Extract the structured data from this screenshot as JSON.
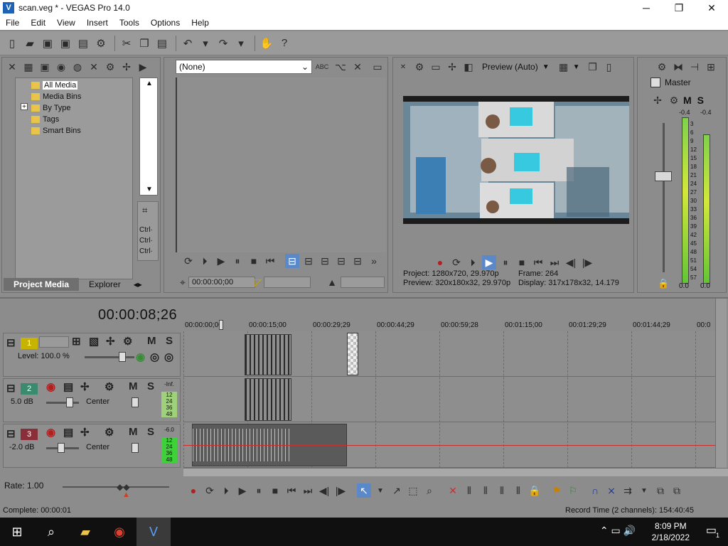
{
  "window": {
    "title": "scan.veg * - VEGAS Pro 14.0",
    "controls": [
      "─",
      "❐",
      "✕"
    ]
  },
  "menu": [
    "File",
    "Edit",
    "View",
    "Insert",
    "Tools",
    "Options",
    "Help"
  ],
  "project_media": {
    "tree": [
      "All Media",
      "Media Bins",
      "By Type",
      "Tags",
      "Smart Bins"
    ],
    "expand_symbol": "+",
    "ctrl_labels": [
      "Ctrl·",
      "Ctrl·",
      "Ctrl·"
    ],
    "tabs": [
      "Project Media",
      "Explorer"
    ]
  },
  "trimmer": {
    "dropdown_value": "(None)",
    "timecode": "00:00:00;00"
  },
  "preview": {
    "mode": "Preview (Auto)",
    "project_label": "Project:",
    "project_value": "1280x720, 29.970p",
    "preview_label": "Preview:",
    "preview_value": "320x180x32, 29.970p",
    "frame_label": "Frame:",
    "frame_value": "264",
    "display_label": "Display:",
    "display_value": "317x178x32, 14.179"
  },
  "master": {
    "title": "Master",
    "mute": "M",
    "solo": "S",
    "peak_left": "-0.4",
    "peak_right": "-0.4",
    "scale": [
      "3",
      "6",
      "9",
      "12",
      "15",
      "18",
      "21",
      "24",
      "27",
      "30",
      "33",
      "36",
      "39",
      "42",
      "45",
      "48",
      "51",
      "54",
      "57"
    ],
    "bottom_left": "0.0",
    "bottom_right": "0.0"
  },
  "timeline": {
    "cursor_time": "00:00:08;26",
    "ruler": [
      "00:00:00;00",
      "00:00:15;00",
      "00:00:29;29",
      "00:00:44;29",
      "00:00:59;28",
      "00:01:15;00",
      "00:01:29;29",
      "00:01:44;29",
      "00:0"
    ],
    "tracks": [
      {
        "number": "1",
        "type": "video",
        "info": "Level: 100.0 %",
        "color": "#c8b400"
      },
      {
        "number": "2",
        "type": "audio",
        "info": "5.0 dB",
        "pan": "Center",
        "meter_top": "-Inf.",
        "meter_scale": [
          "12",
          "24",
          "36",
          "48"
        ],
        "color": "#3a8a6e"
      },
      {
        "number": "3",
        "type": "audio",
        "info": "-2.0 dB",
        "pan": "Center",
        "meter_top": "-6.0",
        "meter_scale": [
          "12",
          "24",
          "36",
          "48"
        ],
        "color": "#8a2e3a"
      }
    ],
    "mute": "M",
    "solo": "S"
  },
  "transport": {
    "rate": "Rate: 1.00"
  },
  "status": {
    "left": "Complete: 00:00:01",
    "right": "Record Time (2 channels): 154:40:45"
  },
  "taskbar": {
    "time": "8:09 PM",
    "date": "2/18/2022",
    "notifications": "1"
  }
}
